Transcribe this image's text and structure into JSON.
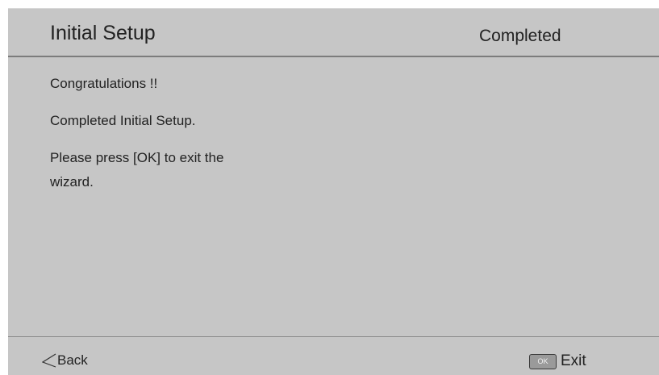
{
  "header": {
    "title": "Initial Setup",
    "status": "Completed"
  },
  "content": {
    "lines": [
      "Congratulations !!",
      "Completed Initial Setup.",
      "Please press [OK] to exit the",
      "wizard."
    ]
  },
  "footer": {
    "back_label": "Back",
    "back_icon": "back-arrow-icon",
    "ok_key_label": "OK",
    "exit_label": "Exit"
  },
  "colors": {
    "background": "#c6c6c6",
    "divider": "#7c7c7c",
    "text": "#222222"
  }
}
